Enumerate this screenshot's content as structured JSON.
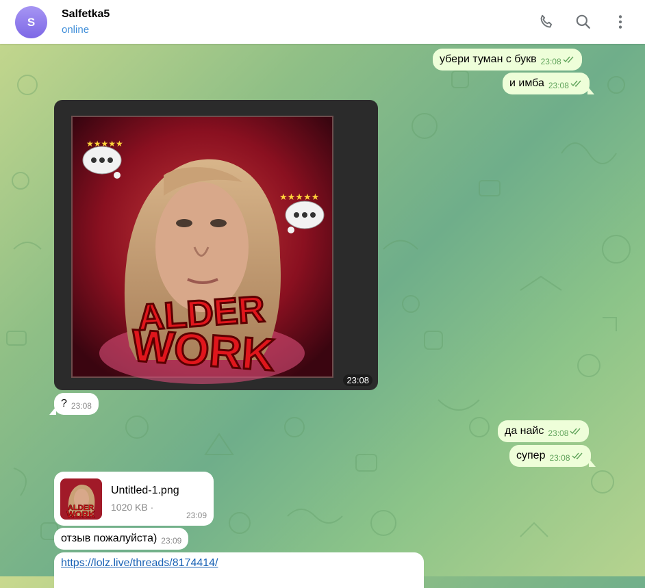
{
  "header": {
    "avatar_letter": "S",
    "name": "Salfetka5",
    "status": "online",
    "icons": [
      "phone-icon",
      "search-icon",
      "more-vertical-icon"
    ]
  },
  "messages": [
    {
      "id": "m1",
      "direction": "out",
      "text": "убери туман с букв",
      "time": "23:08",
      "read": true
    },
    {
      "id": "m2",
      "direction": "out",
      "text": "и имба",
      "time": "23:08",
      "read": true
    },
    {
      "id": "m3",
      "direction": "in",
      "type": "photo",
      "time": "23:08",
      "image_text": {
        "line1": "ALDER",
        "line2": "WORK"
      }
    },
    {
      "id": "m4",
      "direction": "in",
      "text": "?",
      "time": "23:08"
    },
    {
      "id": "m5",
      "direction": "out",
      "text": "да найс",
      "time": "23:08",
      "read": true
    },
    {
      "id": "m6",
      "direction": "out",
      "text": "супер",
      "time": "23:08",
      "read": true
    },
    {
      "id": "m7",
      "direction": "in",
      "type": "file",
      "file_name": "Untitled-1.png",
      "file_size": "1020 KB ·",
      "time": "23:09",
      "thumb_text": {
        "line1": "ALDER",
        "line2": "WORK"
      }
    },
    {
      "id": "m8",
      "direction": "in",
      "text": "отзыв пожалуйста)",
      "time": "23:09"
    },
    {
      "id": "m9",
      "direction": "in",
      "type": "link",
      "text": "https://lolz.live/threads/8174414/"
    }
  ],
  "colors": {
    "outgoing_bubble": "#eefed9",
    "incoming_bubble": "#ffffff",
    "read_check": "#5fa35a",
    "status_online": "#3f8ed9",
    "avatar": "#8b78ea",
    "link": "#1a62b5"
  }
}
